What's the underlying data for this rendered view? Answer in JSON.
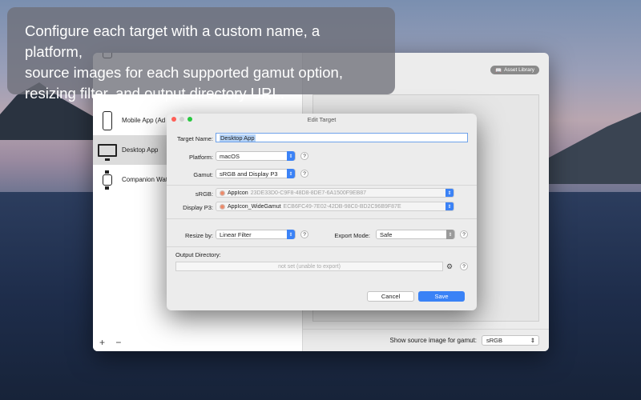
{
  "caption": {
    "line1": "Configure each target with a custom name, a platform,",
    "line2": "source images for each supported gamut option,",
    "line3": "resizing filter, and output directory URL."
  },
  "main_window": {
    "asset_library_label": "Asset Library",
    "sidebar": {
      "items": [
        {
          "label": "Mobile App (Ad S",
          "icon": "phone-icon"
        },
        {
          "label": "Desktop App",
          "icon": "monitor-icon",
          "selected": true
        },
        {
          "label": "Companion Watc",
          "icon": "watch-icon"
        }
      ],
      "add_label": "+",
      "remove_label": "−"
    },
    "bottom_bar": {
      "label": "Show source image for gamut:",
      "value": "sRGB"
    }
  },
  "dialog": {
    "title": "Edit Target",
    "target_name_label": "Target Name:",
    "target_name_value": "Desktop App",
    "platform_label": "Platform:",
    "platform_value": "macOS",
    "gamut_label": "Gamut:",
    "gamut_value": "sRGB and Display P3",
    "srgb_label": "sRGB:",
    "srgb_name": "AppIcon",
    "srgb_uuid": "23DE33D0-C9F8-48D8-8DE7-6A1500F9EB87",
    "p3_label": "Display P3:",
    "p3_name": "AppIcon_WideGamut",
    "p3_uuid": "ECB6FC49-7E02-42DB-98C0-BD2C96B9F87E",
    "resize_label": "Resize by:",
    "resize_value": "Linear Filter",
    "export_label": "Export Mode:",
    "export_value": "Safe",
    "output_label": "Output Directory:",
    "output_placeholder": "not set (unable to export)",
    "help_glyph": "?",
    "cancel_label": "Cancel",
    "save_label": "Save"
  },
  "colors": {
    "accent": "#3a82f6",
    "close": "#ff5f57",
    "zoom": "#28c840"
  }
}
